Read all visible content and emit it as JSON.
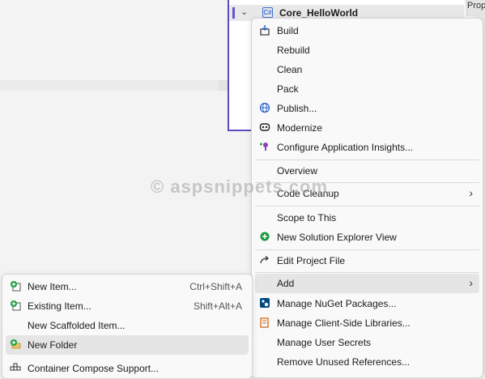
{
  "solution_explorer": {
    "project_name": "Core_HelloWorld",
    "project_icon_text": "C#",
    "properties_tab": "Prop"
  },
  "context_menu": {
    "items": [
      {
        "label": "Build",
        "icon": "build-icon"
      },
      {
        "label": "Rebuild"
      },
      {
        "label": "Clean"
      },
      {
        "label": "Pack"
      },
      {
        "label": "Publish...",
        "icon": "globe-icon"
      },
      {
        "label": "Modernize",
        "icon": "copilot-icon"
      },
      {
        "label": "Configure Application Insights...",
        "icon": "insights-icon"
      },
      {
        "label": "Overview"
      },
      {
        "label": "Code Cleanup",
        "submenu": true
      },
      {
        "label": "Scope to This"
      },
      {
        "label": "New Solution Explorer View",
        "icon": "new-view-icon"
      },
      {
        "label": "Edit Project File",
        "icon": "redo-arrow-icon"
      },
      {
        "label": "Add",
        "submenu": true,
        "highlighted": true
      },
      {
        "label": "Manage NuGet Packages...",
        "icon": "nuget-icon"
      },
      {
        "label": "Manage Client-Side Libraries...",
        "icon": "libman-icon"
      },
      {
        "label": "Manage User Secrets"
      },
      {
        "label": "Remove Unused References..."
      }
    ]
  },
  "add_submenu": {
    "items": [
      {
        "label": "New Item...",
        "shortcut": "Ctrl+Shift+A",
        "icon": "new-item-icon"
      },
      {
        "label": "Existing Item...",
        "shortcut": "Shift+Alt+A",
        "icon": "existing-item-icon"
      },
      {
        "label": "New Scaffolded Item...",
        "shortcut": ""
      },
      {
        "label": "New Folder",
        "shortcut": "",
        "icon": "new-folder-icon",
        "highlighted": true
      },
      {
        "label": "Container Compose Support...",
        "shortcut": "",
        "icon": "container-icon"
      }
    ]
  },
  "watermark": "© aspsnippets.com",
  "colors": {
    "accent": "#5b4bbd",
    "highlight": "#e5e5e5",
    "green_plus": "#1a9a3a",
    "nuget_blue": "#004880"
  }
}
